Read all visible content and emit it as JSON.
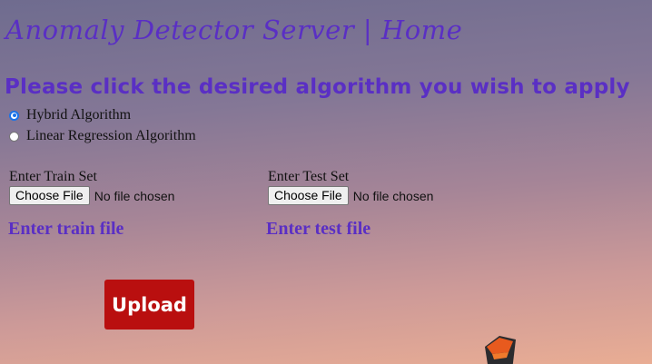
{
  "header": {
    "title": "Anomaly Detector Server | Home"
  },
  "prompt": {
    "text": "Please click the desired algorithm you wish to apply"
  },
  "algorithms": {
    "options": [
      {
        "label": "Hybrid Algorithm",
        "checked": true
      },
      {
        "label": "Linear Regression Algorithm",
        "checked": false
      }
    ]
  },
  "train": {
    "label": "Enter Train Set",
    "button": "Choose File",
    "status": "No file chosen",
    "hint": "Enter train file"
  },
  "test": {
    "label": "Enter Test Set",
    "button": "Choose File",
    "status": "No file chosen",
    "hint": "Enter test file"
  },
  "actions": {
    "upload_label": "Upload"
  },
  "colors": {
    "heading": "#5a2fc4",
    "upload_bg": "#b90f0f",
    "radio_accent": "#1a73e8"
  }
}
